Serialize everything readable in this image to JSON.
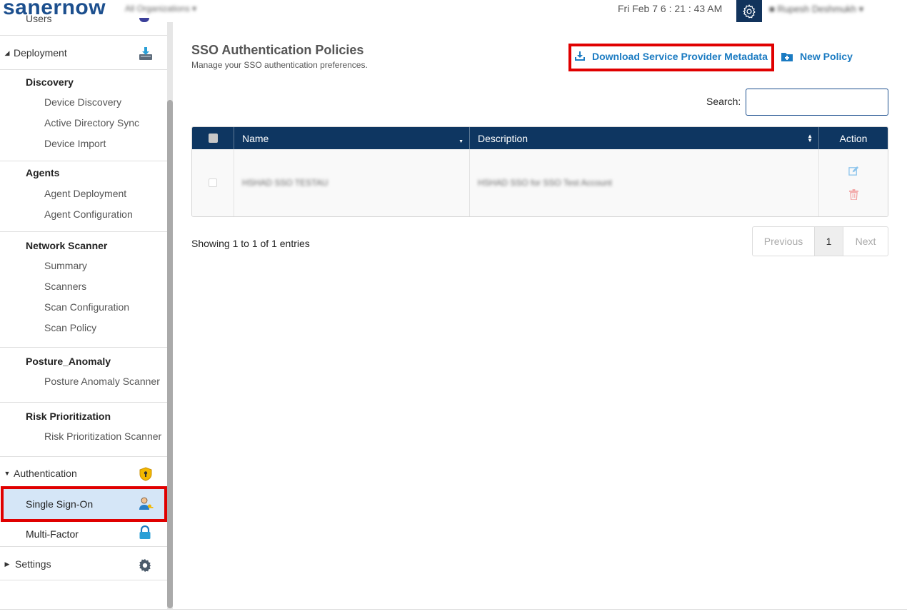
{
  "header": {
    "logo_part1": "saner",
    "logo_part2": "now",
    "org_select": "All Organizations",
    "datetime": "Fri Feb 7   6 : 21 : 43 AM",
    "user_name": "Rupesh Deshmukh"
  },
  "sidebar": {
    "cut_top_label": "Users",
    "deployment": "Deployment",
    "discovery": {
      "title": "Discovery",
      "items": [
        "Device Discovery",
        "Active Directory Sync",
        "Device Import"
      ]
    },
    "agents": {
      "title": "Agents",
      "items": [
        "Agent Deployment",
        "Agent Configuration"
      ]
    },
    "network_scanner": {
      "title": "Network Scanner",
      "items": [
        "Summary",
        "Scanners",
        "Scan Configuration",
        "Scan Policy"
      ]
    },
    "posture": {
      "title": "Posture_Anomaly",
      "items": [
        "Posture Anomaly Scanner"
      ]
    },
    "risk": {
      "title": "Risk Prioritization",
      "items": [
        "Risk Prioritization Scanner"
      ]
    },
    "authentication": "Authentication",
    "sso": "Single Sign-On",
    "mfa": "Multi-Factor",
    "settings": "Settings"
  },
  "main": {
    "title": "SSO Authentication Policies",
    "subtitle": "Manage your SSO authentication preferences.",
    "download_label": "Download Service Provider Metadata",
    "new_policy_label": "New Policy",
    "search_label": "Search:",
    "search_value": "",
    "table": {
      "headers": {
        "name": "Name",
        "description": "Description",
        "action": "Action"
      },
      "rows": [
        {
          "name": "HSHAD SSO TESTAU",
          "description": "HSHAD SSO for SSO Test Account"
        }
      ]
    },
    "showing": "Showing 1 to 1 of 1 entries",
    "pager": {
      "prev": "Previous",
      "current": "1",
      "next": "Next"
    }
  },
  "colors": {
    "brand": "#1c4f8e",
    "header_bg": "#0e3661",
    "link": "#1b7bc2",
    "highlight": "#e00000",
    "selected_bg": "#d5e6f7"
  }
}
